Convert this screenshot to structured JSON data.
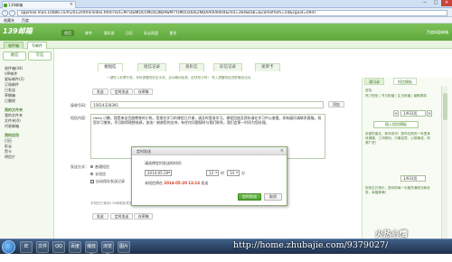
{
  "browser": {
    "tab_title": "139邮箱",
    "close_glyph": "×",
    "min_glyph": "─",
    "max_glyph": "□",
    "win_close_glyph": "×",
    "back_glyph": "‹",
    "forward_glyph": "›",
    "url": "appmail.mail.10086.cn/m2012/html/index.html?sid=MTQwMDU1MDQ3NzAwMTYzMzI3ODk2NQAA000004&rnd=364&tab=&comefrom=54&cguid=0947",
    "bookmarks": [
      "收藏夹",
      "百度"
    ]
  },
  "header": {
    "logo": "139邮箱",
    "nav": [
      "首页",
      "邮件",
      "通讯录",
      "日历",
      "彩云网盘",
      "更多"
    ],
    "user": "百度网盘邮箱"
  },
  "subtabs": [
    "收件箱",
    "写邮件"
  ],
  "sidebar": {
    "compose_button": "收信",
    "write_button": "写信",
    "items": [
      "收件箱(44)",
      "VIP邮件",
      "星标邮件(2)",
      "订阅邮件",
      "已发送",
      "草稿箱",
      "已删除"
    ],
    "group_my_folders": "我的文件夹",
    "folder_items": [
      "我的文件夹",
      "文件夹(0)",
      "代收邮箱"
    ],
    "group_apps": "我的应用",
    "app_items": [
      "日历",
      "彩云",
      "贺卡",
      "明信片"
    ]
  },
  "content": {
    "tabs": [
      "发短信",
      "短信记录",
      "发彩信",
      "彩信记录",
      "发贺卡"
    ],
    "notice": "一键导入彩票开奖、号码提醒短信至手机，活动期间免费，赶快抢订吧！ 导入提醒短信进群赚钱活动",
    "toolbar_top": [
      "发送",
      "定时发送",
      "存草稿"
    ],
    "recipient_label": "接收号码：",
    "recipient_value": "15614328391",
    "add_contact": "添加",
    "message_label": "短信内容：",
    "message_text": "Hello 小鹏，我是来自百度教育的小陈，您报名学习的课程已开课，请及时登录学习。课程回放及资料请在学习中心查看，如有疑问请联系客服。祝您学习愉快，早日取得理想成绩，加油！谢谢您的支持，有任何问题随时与我们联系，我们会第一时间为您处理。",
    "send_type_label": "发送方式：",
    "option_normal": "普通短信",
    "option_long": "长短信",
    "option_auto_save": "自动保存发送记录",
    "footer_hint": "本短信已使用139邮箱免费发送，接收方不需要支付任何费用",
    "toolbar_bottom": [
      "发送",
      "定时发送",
      "存草稿"
    ]
  },
  "right_panel": {
    "tabs": [
      "通讯录",
      "短信模板"
    ],
    "search_label": "查找",
    "categories": "热门短信 | 节日祝福 | 生日祝福 | 幽默搞笑",
    "page": "1/933页",
    "prev": "<",
    "next": ">",
    "insert_button": "插入短信模板",
    "snippet1": "亲爱的朋友，新年快乐！愿你在新的一年里身体健康，工作顺利，万事如意，心想事成，财源广进！",
    "snippet2": "祝你生日快乐，愿你的每一天都充满阳光和欢笑，幸福美满！",
    "page2": "1/933页"
  },
  "dialog": {
    "title": "定时发送",
    "close": "×",
    "prompt": "请选择定时发送的时间：",
    "date": "2014-05-20",
    "hour": "13",
    "hour_unit": "时",
    "minute": "14",
    "minute_unit": "分",
    "info_prefix": "本短信将在",
    "info_datetime": "2014-05-20 13:14",
    "info_suffix": "发送",
    "ok": "定时发送",
    "cancel": "取消"
  },
  "taskbar": {
    "icons": [
      "IE",
      "文件夹",
      "QQ",
      "百度",
      "播放器",
      "浏览器",
      "图片"
    ]
  },
  "watermark": {
    "line1": "火热心情",
    "url": "http://home.zhubajie.com/9379027/"
  }
}
